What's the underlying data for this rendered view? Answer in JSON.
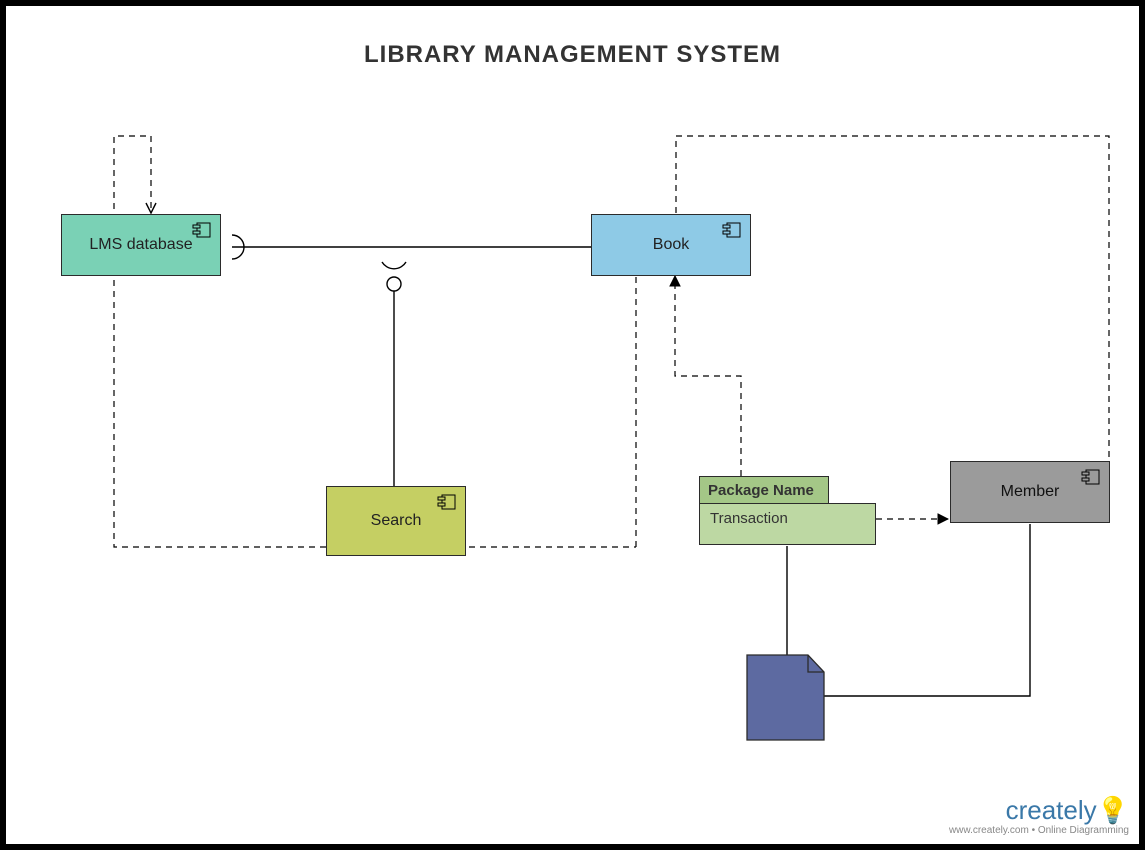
{
  "title": "LIBRARY MANAGEMENT SYSTEM",
  "components": {
    "lms": {
      "label": "LMS database",
      "fill": "#7ad1b5"
    },
    "book": {
      "label": "Book",
      "fill": "#8ecae6"
    },
    "search": {
      "label": "Search",
      "fill": "#c5cf63"
    },
    "member": {
      "label": "Member",
      "fill": "#9b9b9b"
    }
  },
  "package": {
    "tab_label": "Package Name",
    "body_label": "Transaction",
    "tab_fill": "#a4c787",
    "body_fill": "#bdd8a3"
  },
  "note": {
    "fill": "#5d6aa1"
  },
  "brand": {
    "name": "creately",
    "tagline": "www.creately.com • Online Diagramming"
  },
  "connectors": [
    {
      "from": "book",
      "to": "lms",
      "style": "dashed-arrow",
      "route": "top-loop"
    },
    {
      "from": "lms",
      "to": "book",
      "style": "interface",
      "route": "horizontal"
    },
    {
      "from": "search",
      "to": "interface-midpoint",
      "style": "required-interface"
    },
    {
      "from": "search",
      "to": "lms",
      "style": "dashed-arrow",
      "route": "left-bottom"
    },
    {
      "from": "package",
      "to": "book",
      "style": "dashed-arrow",
      "route": "up"
    },
    {
      "from": "package",
      "to": "member",
      "style": "dashed-arrow",
      "route": "right"
    },
    {
      "from": "package",
      "to": "note",
      "style": "solid"
    },
    {
      "from": "member",
      "to": "note",
      "style": "solid",
      "route": "down-left"
    }
  ]
}
